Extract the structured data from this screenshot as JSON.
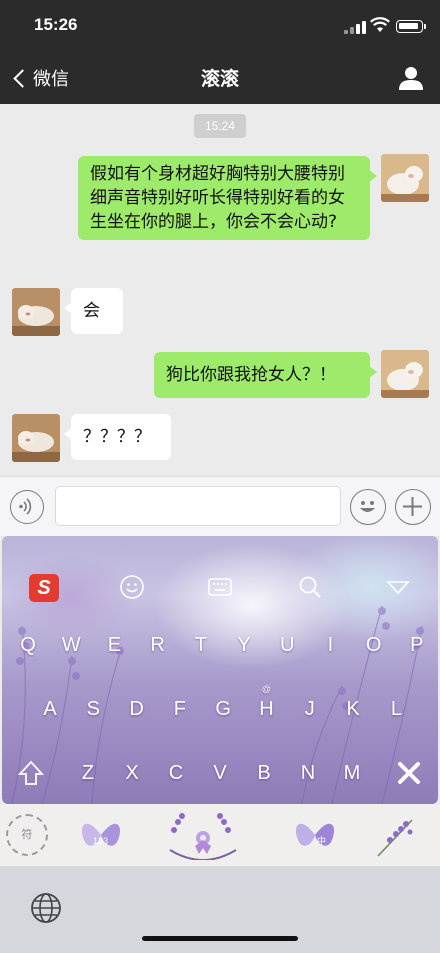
{
  "status": {
    "time": "15:26"
  },
  "nav": {
    "back_label": "微信",
    "title": "滚滚"
  },
  "chat": {
    "timestamp": "15:24",
    "messages": [
      {
        "from": "me",
        "text": "假如有个身材超好胸特别大腰特别细声音特别好听长得特别好看的女生坐在你的腿上，你会不会心动?"
      },
      {
        "from": "other",
        "text": "会"
      },
      {
        "from": "me",
        "text": "狗比你跟我抢女人？！"
      },
      {
        "from": "other",
        "text": "？？？？"
      }
    ]
  },
  "input": {
    "value": ""
  },
  "keyboard": {
    "brand": "S",
    "row1": [
      "Q",
      "W",
      "E",
      "R",
      "T",
      "Y",
      "U",
      "I",
      "O",
      "P"
    ],
    "row2": [
      "A",
      "S",
      "D",
      "F",
      "G",
      "H",
      "J",
      "K",
      "L"
    ],
    "row2_sub": [
      "",
      "",
      "",
      "",
      "",
      "@",
      "",
      "",
      ""
    ],
    "row3": [
      "Z",
      "X",
      "C",
      "V",
      "B",
      "N",
      "M"
    ],
    "row1_sub": [
      "",
      "",
      "",
      "",
      "",
      "",
      "",
      "",
      "",
      ""
    ]
  },
  "stickers": {
    "stamp_text": "符",
    "butterfly_left": "123",
    "butterfly_right": "中"
  },
  "colors": {
    "my_bubble": "#9eea6a",
    "nav_bg": "#2b2b2b",
    "chat_bg": "#ebebeb"
  }
}
